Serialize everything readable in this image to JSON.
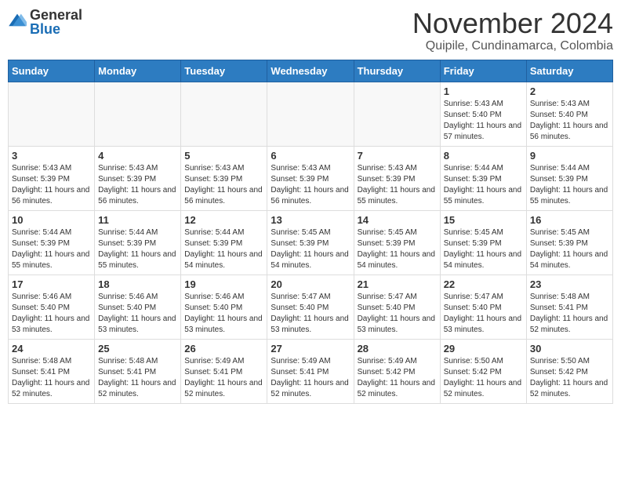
{
  "logo": {
    "general": "General",
    "blue": "Blue"
  },
  "header": {
    "month": "November 2024",
    "location": "Quipile, Cundinamarca, Colombia"
  },
  "weekdays": [
    "Sunday",
    "Monday",
    "Tuesday",
    "Wednesday",
    "Thursday",
    "Friday",
    "Saturday"
  ],
  "weeks": [
    [
      {
        "day": "",
        "empty": true
      },
      {
        "day": "",
        "empty": true
      },
      {
        "day": "",
        "empty": true
      },
      {
        "day": "",
        "empty": true
      },
      {
        "day": "",
        "empty": true
      },
      {
        "day": "1",
        "sunrise": "Sunrise: 5:43 AM",
        "sunset": "Sunset: 5:40 PM",
        "daylight": "Daylight: 11 hours and 57 minutes."
      },
      {
        "day": "2",
        "sunrise": "Sunrise: 5:43 AM",
        "sunset": "Sunset: 5:40 PM",
        "daylight": "Daylight: 11 hours and 56 minutes."
      }
    ],
    [
      {
        "day": "3",
        "sunrise": "Sunrise: 5:43 AM",
        "sunset": "Sunset: 5:39 PM",
        "daylight": "Daylight: 11 hours and 56 minutes."
      },
      {
        "day": "4",
        "sunrise": "Sunrise: 5:43 AM",
        "sunset": "Sunset: 5:39 PM",
        "daylight": "Daylight: 11 hours and 56 minutes."
      },
      {
        "day": "5",
        "sunrise": "Sunrise: 5:43 AM",
        "sunset": "Sunset: 5:39 PM",
        "daylight": "Daylight: 11 hours and 56 minutes."
      },
      {
        "day": "6",
        "sunrise": "Sunrise: 5:43 AM",
        "sunset": "Sunset: 5:39 PM",
        "daylight": "Daylight: 11 hours and 56 minutes."
      },
      {
        "day": "7",
        "sunrise": "Sunrise: 5:43 AM",
        "sunset": "Sunset: 5:39 PM",
        "daylight": "Daylight: 11 hours and 55 minutes."
      },
      {
        "day": "8",
        "sunrise": "Sunrise: 5:44 AM",
        "sunset": "Sunset: 5:39 PM",
        "daylight": "Daylight: 11 hours and 55 minutes."
      },
      {
        "day": "9",
        "sunrise": "Sunrise: 5:44 AM",
        "sunset": "Sunset: 5:39 PM",
        "daylight": "Daylight: 11 hours and 55 minutes."
      }
    ],
    [
      {
        "day": "10",
        "sunrise": "Sunrise: 5:44 AM",
        "sunset": "Sunset: 5:39 PM",
        "daylight": "Daylight: 11 hours and 55 minutes."
      },
      {
        "day": "11",
        "sunrise": "Sunrise: 5:44 AM",
        "sunset": "Sunset: 5:39 PM",
        "daylight": "Daylight: 11 hours and 55 minutes."
      },
      {
        "day": "12",
        "sunrise": "Sunrise: 5:44 AM",
        "sunset": "Sunset: 5:39 PM",
        "daylight": "Daylight: 11 hours and 54 minutes."
      },
      {
        "day": "13",
        "sunrise": "Sunrise: 5:45 AM",
        "sunset": "Sunset: 5:39 PM",
        "daylight": "Daylight: 11 hours and 54 minutes."
      },
      {
        "day": "14",
        "sunrise": "Sunrise: 5:45 AM",
        "sunset": "Sunset: 5:39 PM",
        "daylight": "Daylight: 11 hours and 54 minutes."
      },
      {
        "day": "15",
        "sunrise": "Sunrise: 5:45 AM",
        "sunset": "Sunset: 5:39 PM",
        "daylight": "Daylight: 11 hours and 54 minutes."
      },
      {
        "day": "16",
        "sunrise": "Sunrise: 5:45 AM",
        "sunset": "Sunset: 5:39 PM",
        "daylight": "Daylight: 11 hours and 54 minutes."
      }
    ],
    [
      {
        "day": "17",
        "sunrise": "Sunrise: 5:46 AM",
        "sunset": "Sunset: 5:40 PM",
        "daylight": "Daylight: 11 hours and 53 minutes."
      },
      {
        "day": "18",
        "sunrise": "Sunrise: 5:46 AM",
        "sunset": "Sunset: 5:40 PM",
        "daylight": "Daylight: 11 hours and 53 minutes."
      },
      {
        "day": "19",
        "sunrise": "Sunrise: 5:46 AM",
        "sunset": "Sunset: 5:40 PM",
        "daylight": "Daylight: 11 hours and 53 minutes."
      },
      {
        "day": "20",
        "sunrise": "Sunrise: 5:47 AM",
        "sunset": "Sunset: 5:40 PM",
        "daylight": "Daylight: 11 hours and 53 minutes."
      },
      {
        "day": "21",
        "sunrise": "Sunrise: 5:47 AM",
        "sunset": "Sunset: 5:40 PM",
        "daylight": "Daylight: 11 hours and 53 minutes."
      },
      {
        "day": "22",
        "sunrise": "Sunrise: 5:47 AM",
        "sunset": "Sunset: 5:40 PM",
        "daylight": "Daylight: 11 hours and 53 minutes."
      },
      {
        "day": "23",
        "sunrise": "Sunrise: 5:48 AM",
        "sunset": "Sunset: 5:41 PM",
        "daylight": "Daylight: 11 hours and 52 minutes."
      }
    ],
    [
      {
        "day": "24",
        "sunrise": "Sunrise: 5:48 AM",
        "sunset": "Sunset: 5:41 PM",
        "daylight": "Daylight: 11 hours and 52 minutes."
      },
      {
        "day": "25",
        "sunrise": "Sunrise: 5:48 AM",
        "sunset": "Sunset: 5:41 PM",
        "daylight": "Daylight: 11 hours and 52 minutes."
      },
      {
        "day": "26",
        "sunrise": "Sunrise: 5:49 AM",
        "sunset": "Sunset: 5:41 PM",
        "daylight": "Daylight: 11 hours and 52 minutes."
      },
      {
        "day": "27",
        "sunrise": "Sunrise: 5:49 AM",
        "sunset": "Sunset: 5:41 PM",
        "daylight": "Daylight: 11 hours and 52 minutes."
      },
      {
        "day": "28",
        "sunrise": "Sunrise: 5:49 AM",
        "sunset": "Sunset: 5:42 PM",
        "daylight": "Daylight: 11 hours and 52 minutes."
      },
      {
        "day": "29",
        "sunrise": "Sunrise: 5:50 AM",
        "sunset": "Sunset: 5:42 PM",
        "daylight": "Daylight: 11 hours and 52 minutes."
      },
      {
        "day": "30",
        "sunrise": "Sunrise: 5:50 AM",
        "sunset": "Sunset: 5:42 PM",
        "daylight": "Daylight: 11 hours and 52 minutes."
      }
    ]
  ]
}
